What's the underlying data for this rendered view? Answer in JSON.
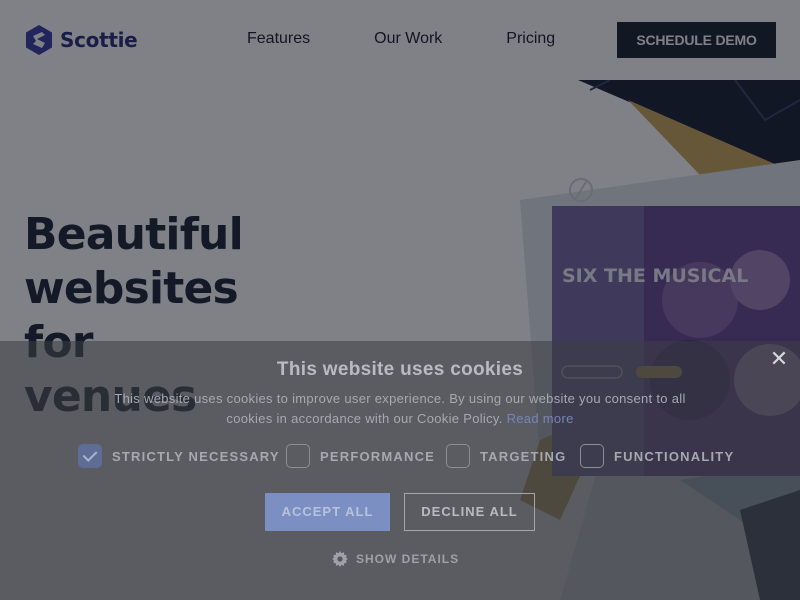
{
  "header": {
    "logo_text": "Scottie",
    "nav": [
      {
        "label": "Features"
      },
      {
        "label": "Our Work"
      },
      {
        "label": "Pricing"
      }
    ],
    "cta_label": "SCHEDULE DEMO"
  },
  "hero": {
    "title_line1": "Beautiful websites",
    "title_line2": "for",
    "title_line3": "venues",
    "poster_title": "SIX THE MUSICAL"
  },
  "cookie_banner": {
    "title": "This website uses cookies",
    "text": "This website uses cookies to improve user experience. By using our website you consent to all cookies in accordance with our Cookie Policy.",
    "read_more": "Read more",
    "options": [
      {
        "label": "STRICTLY NECESSARY",
        "checked": true
      },
      {
        "label": "PERFORMANCE",
        "checked": false
      },
      {
        "label": "TARGETING",
        "checked": false
      },
      {
        "label": "FUNCTIONALITY",
        "checked": false
      }
    ],
    "accept_label": "ACCEPT ALL",
    "decline_label": "DECLINE ALL",
    "details_label": "SHOW DETAILS",
    "close_glyph": "✕"
  },
  "colors": {
    "brand": "#2a2f7a",
    "cta_bg": "#1c2331",
    "accept_bg": "#7b8fc2",
    "poster_purple": "#5b3f8a",
    "poster_gold": "#c9a85a"
  },
  "icons": [
    "scottie-logo-icon",
    "close-icon",
    "check-icon",
    "gear-icon"
  ]
}
